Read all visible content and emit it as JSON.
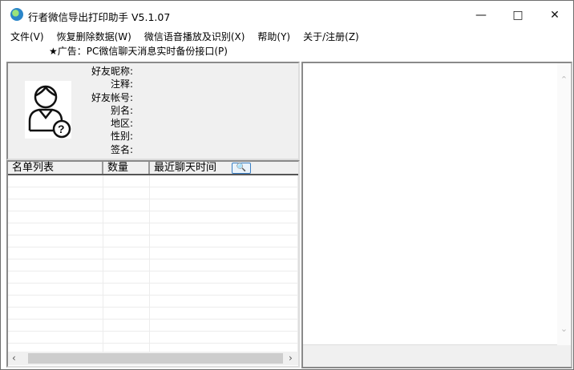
{
  "window": {
    "title": "行者微信导出打印助手  V5.1.07"
  },
  "menu": [
    "文件(V)",
    "恢复删除数据(W)",
    "微信语音播放及识别(X)",
    "帮助(Y)",
    "关于/注册(Z)"
  ],
  "ad": "★广告：PC微信聊天消息实时备份接口(P)",
  "profile": {
    "labels": [
      "好友昵称:",
      "注释:",
      "好友帐号:",
      "别名:",
      "地区:",
      "性别:",
      "签名:"
    ]
  },
  "list": {
    "columns": [
      "名单列表",
      "数量",
      "最近聊天时间"
    ]
  }
}
